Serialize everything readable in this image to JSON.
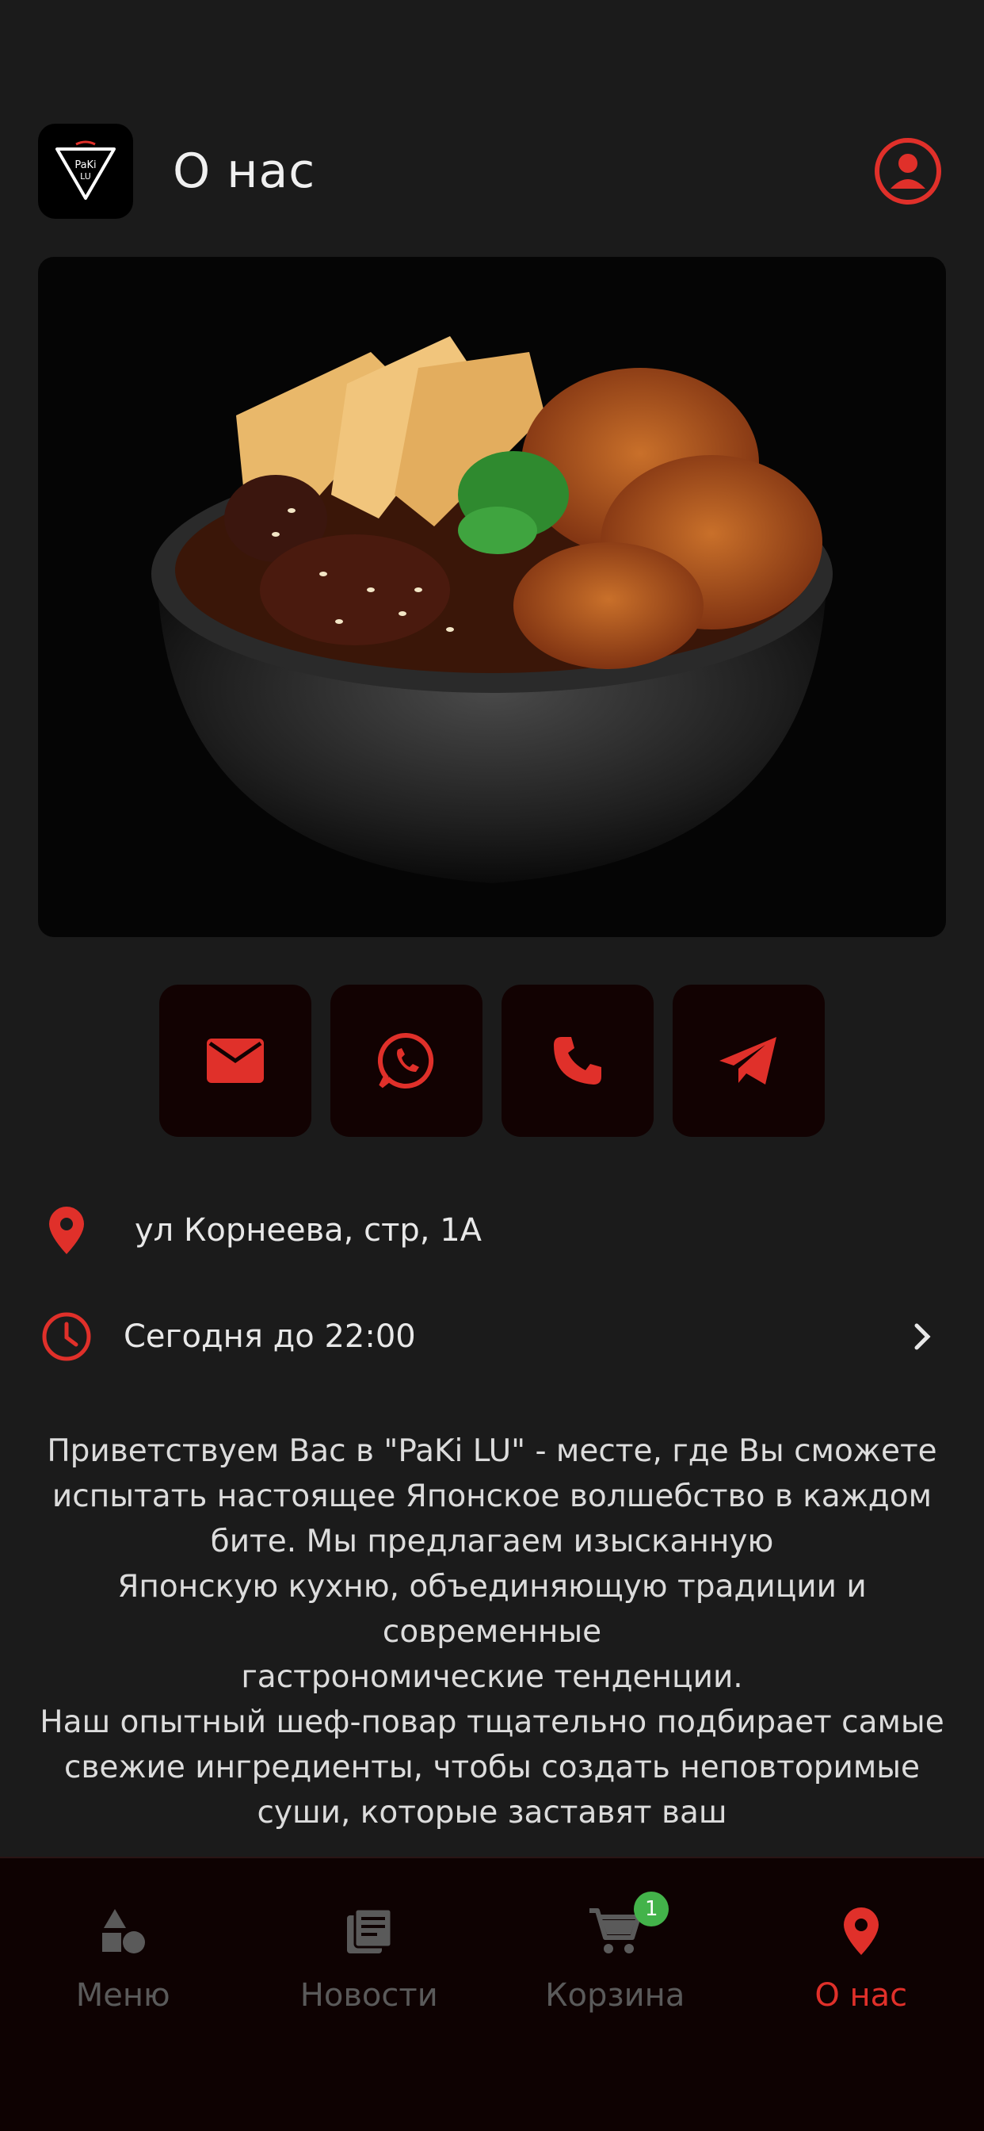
{
  "header": {
    "title": "О нас",
    "logo_text": "PaKi LU"
  },
  "hero": {
    "alt": "food bowl photo"
  },
  "contacts": [
    {
      "name": "email",
      "icon": "mail-icon"
    },
    {
      "name": "whatsapp",
      "icon": "whatsapp-icon"
    },
    {
      "name": "phone",
      "icon": "phone-icon"
    },
    {
      "name": "telegram",
      "icon": "telegram-icon"
    }
  ],
  "info": {
    "address": "ул Корнеева, стр, 1А",
    "hours": "Сегодня до 22:00"
  },
  "description": "Приветствуем Вас в \"PaKi LU\" - месте, где Вы сможете испытать настоящее Японское волшебство в каждом бите. Мы предлагаем изысканную\nЯпонскую кухню, объединяющую традиции и современные\nгастрономические тенденции.\nНаш опытный шеф-повар тщательно подбирает самые свежие ингредиенты, чтобы создать неповторимые суши, которые заставят ваш",
  "nav": {
    "items": [
      {
        "label": "Меню",
        "icon": "menu-shapes-icon"
      },
      {
        "label": "Новости",
        "icon": "news-icon"
      },
      {
        "label": "Корзина",
        "icon": "cart-icon",
        "badge": "1"
      },
      {
        "label": "О нас",
        "icon": "location-icon",
        "active": true
      }
    ]
  },
  "colors": {
    "accent": "#e0302a",
    "background": "#1b1b1b",
    "button_bg": "#120202",
    "badge": "#43b34a",
    "inactive": "#5a5a5a"
  }
}
